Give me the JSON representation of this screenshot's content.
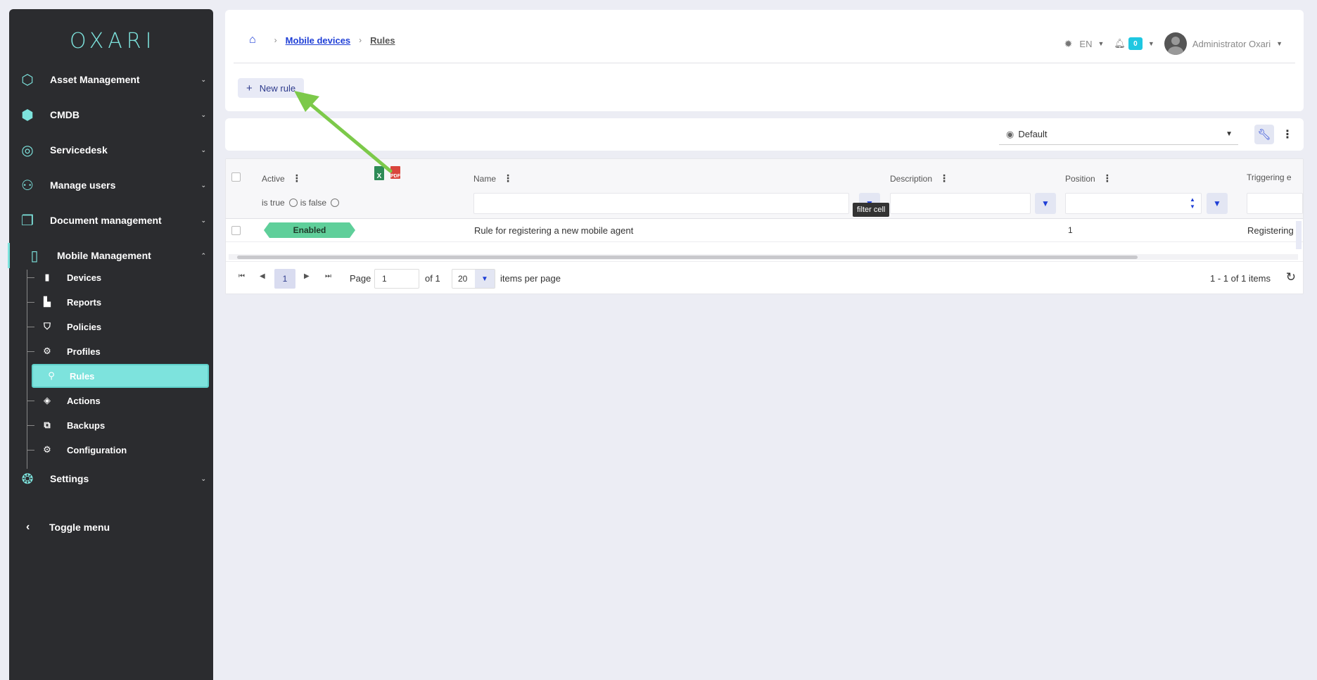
{
  "logo": "OXARI",
  "sidebar": {
    "items": [
      {
        "label": "Asset Management",
        "icon": "molecule-icon"
      },
      {
        "label": "CMDB",
        "icon": "cubes-icon"
      },
      {
        "label": "Servicedesk",
        "icon": "eye-icon"
      },
      {
        "label": "Manage users",
        "icon": "users-icon"
      },
      {
        "label": "Document management",
        "icon": "documents-icon"
      },
      {
        "label": "Mobile Management",
        "icon": "mobile-icon"
      },
      {
        "label": "Settings",
        "icon": "settings-icon"
      }
    ],
    "sub_items": [
      {
        "label": "Devices",
        "icon": "phone-icon"
      },
      {
        "label": "Reports",
        "icon": "chart-icon"
      },
      {
        "label": "Policies",
        "icon": "shield-icon"
      },
      {
        "label": "Profiles",
        "icon": "gear-icon"
      },
      {
        "label": "Rules",
        "icon": "flow-icon"
      },
      {
        "label": "Actions",
        "icon": "target-icon"
      },
      {
        "label": "Backups",
        "icon": "copy-icon"
      },
      {
        "label": "Configuration",
        "icon": "cogs-icon"
      }
    ],
    "toggle_label": "Toggle menu"
  },
  "breadcrumb": {
    "parent": "Mobile devices",
    "current": "Rules"
  },
  "header": {
    "language": "EN",
    "notification_count": "0",
    "user_name": "Administrator Oxari"
  },
  "toolbar": {
    "new_rule_label": "New rule"
  },
  "view": {
    "selected": "Default"
  },
  "grid": {
    "columns": {
      "active": "Active",
      "name": "Name",
      "description": "Description",
      "position": "Position",
      "triggering": "Triggering e"
    },
    "bool_filter": {
      "is_true": "is true",
      "is_false": "is false"
    },
    "tooltip": "filter cell",
    "export_excel": "X",
    "export_pdf": "PDF",
    "rows": [
      {
        "active": "Enabled",
        "name": "Rule for registering a new mobile agent",
        "description": "",
        "position": "1",
        "triggering": "Registering"
      }
    ]
  },
  "pager": {
    "current_page": "1",
    "page_label": "Page",
    "page_input": "1",
    "of_label": "of 1",
    "page_size": "20",
    "items_per_page_label": "items per page",
    "info": "1 - 1 of 1 items"
  },
  "colors": {
    "accent": "#7de3dd",
    "link": "#1f3fd6",
    "enabled": "#5fcf9a",
    "sidebar_bg": "#2b2c2f"
  }
}
